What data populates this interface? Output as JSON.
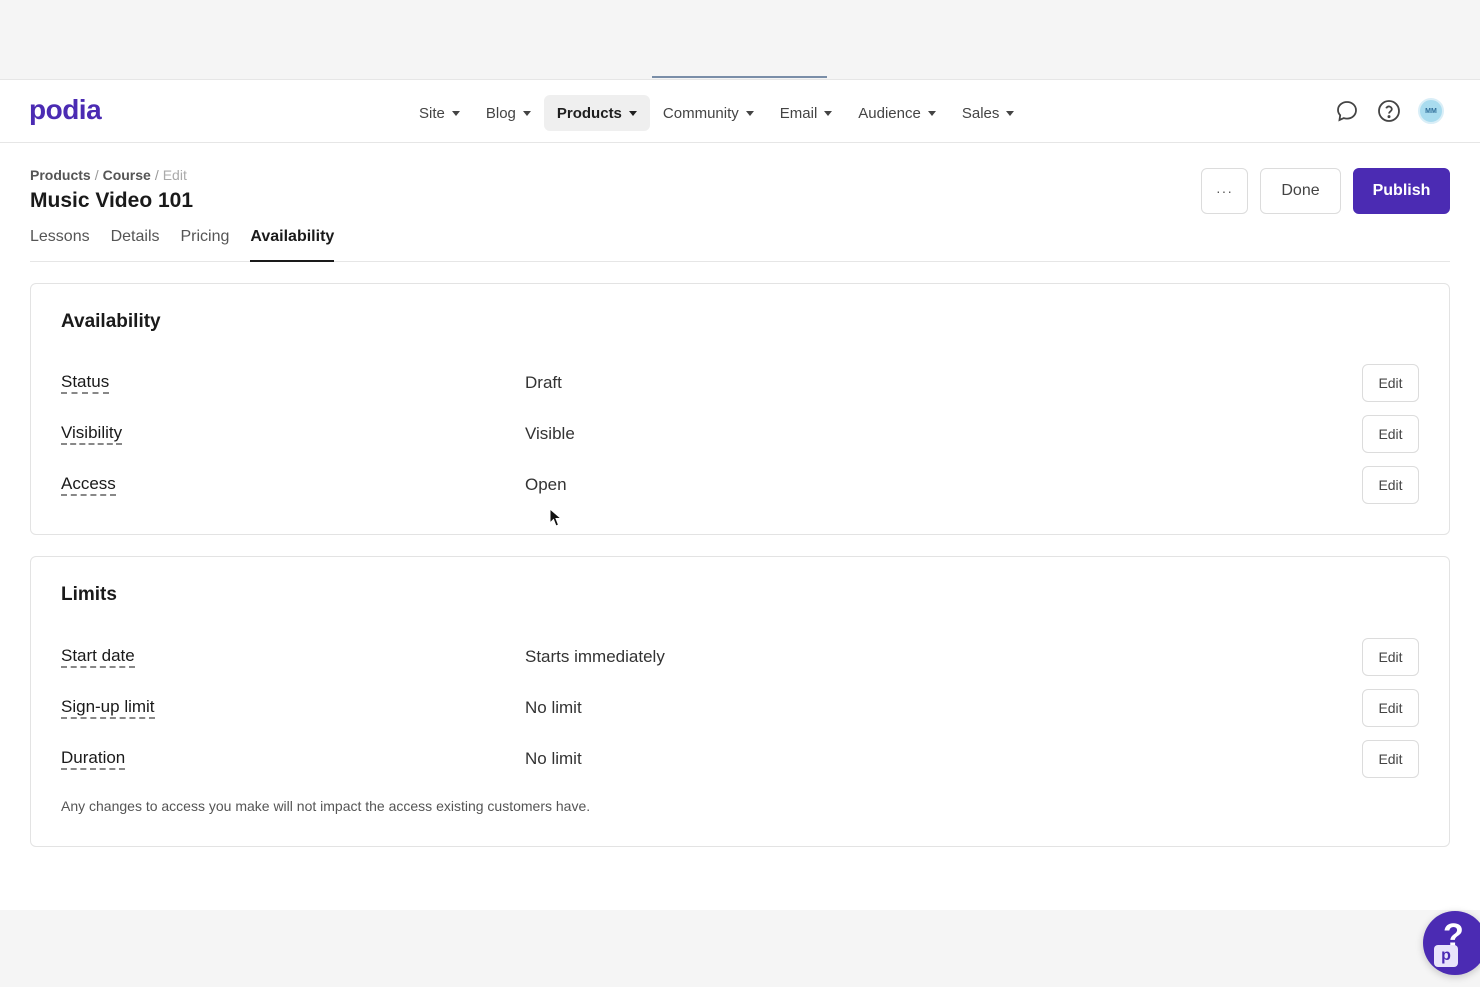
{
  "nav": {
    "logo": "podia",
    "items": [
      {
        "label": "Site",
        "active": false
      },
      {
        "label": "Blog",
        "active": false
      },
      {
        "label": "Products",
        "active": true
      },
      {
        "label": "Community",
        "active": false
      },
      {
        "label": "Email",
        "active": false
      },
      {
        "label": "Audience",
        "active": false
      },
      {
        "label": "Sales",
        "active": false
      }
    ],
    "avatar_initials": "MM"
  },
  "breadcrumb": {
    "products": "Products",
    "course": "Course",
    "edit": "Edit"
  },
  "page_title": "Music Video 101",
  "tabs": [
    "Lessons",
    "Details",
    "Pricing",
    "Availability"
  ],
  "active_tab": "Availability",
  "actions": {
    "more": "···",
    "done": "Done",
    "publish": "Publish"
  },
  "availability": {
    "title": "Availability",
    "rows": [
      {
        "label": "Status",
        "value": "Draft",
        "edit": "Edit"
      },
      {
        "label": "Visibility",
        "value": "Visible",
        "edit": "Edit"
      },
      {
        "label": "Access",
        "value": "Open",
        "edit": "Edit"
      }
    ]
  },
  "limits": {
    "title": "Limits",
    "rows": [
      {
        "label": "Start date",
        "value": "Starts immediately",
        "edit": "Edit"
      },
      {
        "label": "Sign-up limit",
        "value": "No limit",
        "edit": "Edit"
      },
      {
        "label": "Duration",
        "value": "No limit",
        "edit": "Edit"
      }
    ],
    "note": "Any changes to access you make will not impact the access existing customers have."
  },
  "help_widget": {
    "glyph": "?",
    "badge": "p"
  },
  "colors": {
    "brand": "#4b2bb3",
    "text": "#1a1a1a",
    "border": "#e3e3e3"
  },
  "icons": [
    "chat-bubble-icon",
    "help-circle-icon",
    "caret-down-icon",
    "cursor-arrow-icon"
  ]
}
